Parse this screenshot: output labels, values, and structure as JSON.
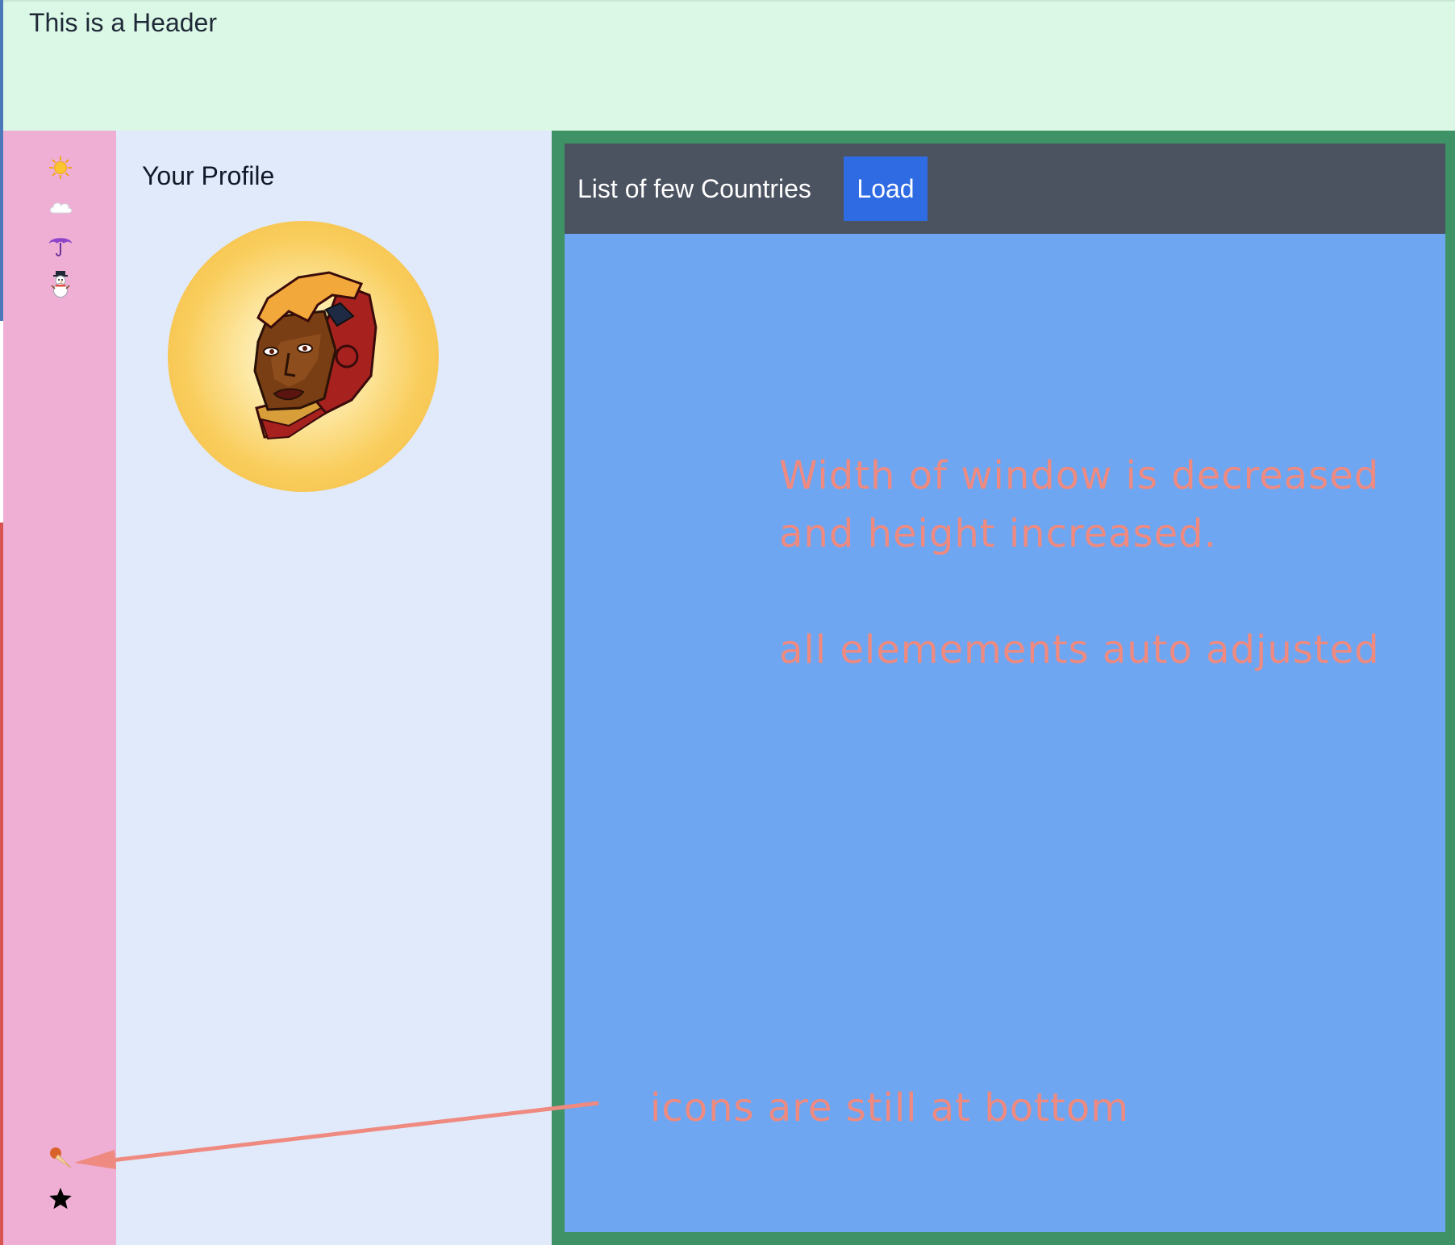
{
  "header": {
    "title": "This is a Header"
  },
  "icon_rail": {
    "top_icons": [
      "sun-icon",
      "cloud-icon",
      "umbrella-icon",
      "snowman-icon"
    ],
    "bottom_icons": [
      "ice-cream-icon",
      "star-icon"
    ]
  },
  "profile": {
    "title": "Your Profile",
    "avatar_icon": "ironman-avatar"
  },
  "main": {
    "toolbar_title": "List of few Countries",
    "load_label": "Load"
  },
  "annotations": {
    "line1": "Width of window is decreased",
    "line2": "and height increased.",
    "line3": "all elemements auto adjusted",
    "line4": "icons are still at bottom",
    "color": "#ef8a80"
  },
  "colors": {
    "header_bg": "#dbf8e6",
    "rail_bg": "#efafd5",
    "profile_bg": "#e0eafa",
    "frame_border": "#3f9265",
    "content_bg": "#6ea6f2",
    "toolbar_bg": "#4b5260",
    "button_bg": "#2f6be3"
  }
}
